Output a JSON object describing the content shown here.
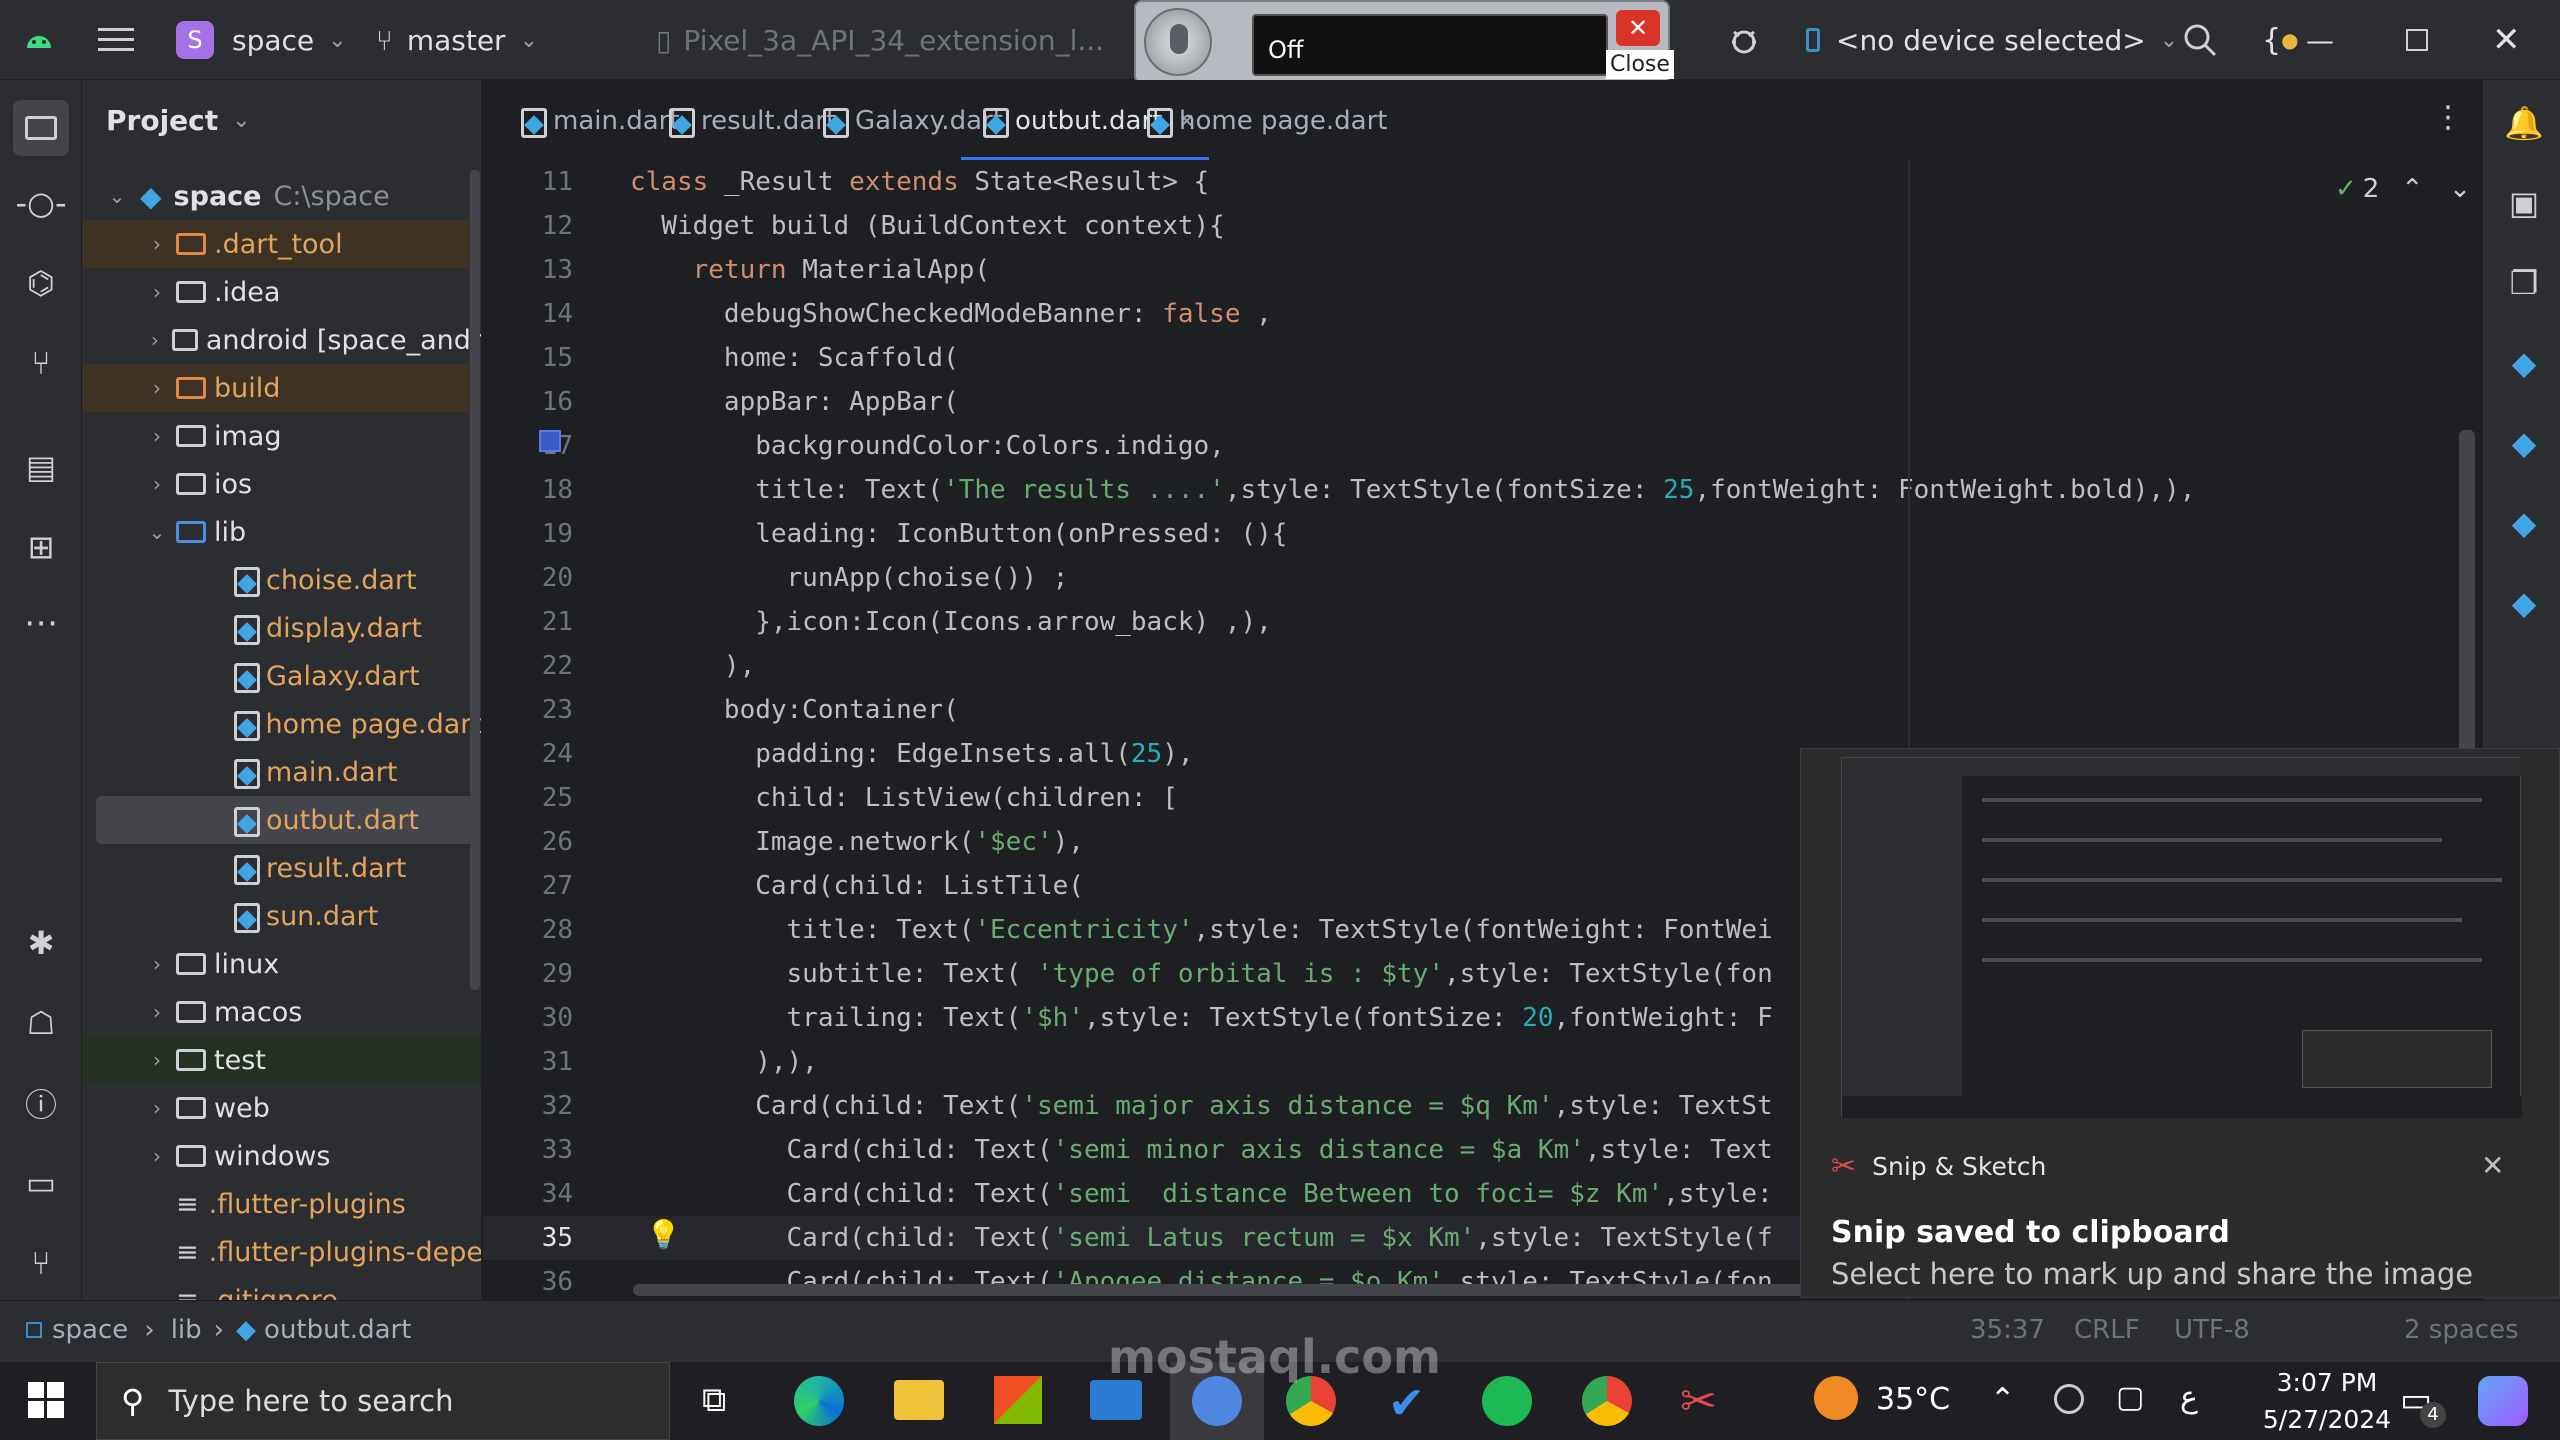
{
  "titlebar": {
    "project_badge": "S",
    "project_name": "space",
    "branch": "master",
    "device_config": "Pixel_3a_API_34_extension_l...",
    "device_selector": "<no device selected>"
  },
  "voice_widget": {
    "status": "Off",
    "close_label": "Close"
  },
  "project_panel": {
    "title": "Project",
    "root_name": "space",
    "root_path": "C:\\space",
    "items": [
      {
        "label": ".dart_tool",
        "kind": "folder",
        "color": "orange"
      },
      {
        "label": ".idea",
        "kind": "folder",
        "color": "normal"
      },
      {
        "label": "android [space_andr",
        "kind": "folder",
        "color": "normal"
      },
      {
        "label": "build",
        "kind": "folder",
        "color": "orange"
      },
      {
        "label": "imag",
        "kind": "folder",
        "color": "normal"
      },
      {
        "label": "ios",
        "kind": "folder",
        "color": "normal"
      },
      {
        "label": "lib",
        "kind": "folder-open",
        "color": "normal"
      },
      {
        "label": "choise.dart",
        "kind": "file",
        "color": "orange"
      },
      {
        "label": "display.dart",
        "kind": "file",
        "color": "orange"
      },
      {
        "label": "Galaxy.dart",
        "kind": "file",
        "color": "orange"
      },
      {
        "label": "home page.dart",
        "kind": "file",
        "color": "orange"
      },
      {
        "label": "main.dart",
        "kind": "file",
        "color": "orange"
      },
      {
        "label": "outbut.dart",
        "kind": "file",
        "color": "orange"
      },
      {
        "label": "result.dart",
        "kind": "file",
        "color": "orange"
      },
      {
        "label": "sun.dart",
        "kind": "file",
        "color": "orange"
      },
      {
        "label": "linux",
        "kind": "folder",
        "color": "normal"
      },
      {
        "label": "macos",
        "kind": "folder",
        "color": "normal"
      },
      {
        "label": "test",
        "kind": "folder",
        "color": "normal"
      },
      {
        "label": "web",
        "kind": "folder",
        "color": "normal"
      },
      {
        "label": "windows",
        "kind": "folder",
        "color": "normal"
      },
      {
        "label": ".flutter-plugins",
        "kind": "text",
        "color": "orange"
      },
      {
        "label": ".flutter-plugins-deper",
        "kind": "text",
        "color": "orange"
      },
      {
        "label": ".gitignore",
        "kind": "text",
        "color": "orange"
      }
    ]
  },
  "tabs": [
    {
      "label": "main.dart",
      "active": false
    },
    {
      "label": "result.dart",
      "active": false
    },
    {
      "label": "Galaxy.dart",
      "active": false
    },
    {
      "label": "outbut.dart",
      "active": true
    },
    {
      "label": "home page.dart",
      "active": false
    }
  ],
  "inspections": {
    "count": "2"
  },
  "code_lines": [
    {
      "n": "11",
      "segs": [
        [
          "kw",
          "class "
        ],
        [
          "",
          "_Result "
        ],
        [
          "kw",
          "extends "
        ],
        [
          "",
          "State<Result> {"
        ]
      ]
    },
    {
      "n": "12",
      "segs": [
        [
          "",
          "  Widget build (BuildContext context){"
        ]
      ]
    },
    {
      "n": "13",
      "segs": [
        [
          "kw",
          "    return "
        ],
        [
          "",
          "MaterialApp("
        ]
      ]
    },
    {
      "n": "14",
      "segs": [
        [
          "",
          "      debugShowCheckedModeBanner: "
        ],
        [
          "kw",
          "false"
        ],
        [
          "",
          " ,"
        ]
      ]
    },
    {
      "n": "15",
      "segs": [
        [
          "",
          "      home: Scaffold("
        ]
      ]
    },
    {
      "n": "16",
      "segs": [
        [
          "",
          "      appBar: AppBar("
        ]
      ]
    },
    {
      "n": "17",
      "segs": [
        [
          "",
          "        backgroundColor:Colors.indigo,"
        ]
      ]
    },
    {
      "n": "18",
      "segs": [
        [
          "",
          "        title: Text("
        ],
        [
          "str",
          "'The results ....'"
        ],
        [
          "",
          ",style: TextStyle(fontSize: "
        ],
        [
          "num",
          "25"
        ],
        [
          "",
          ",fontWeight: FontWeight.bold),),"
        ]
      ]
    },
    {
      "n": "19",
      "segs": [
        [
          "",
          "        leading: IconButton(onPressed: (){"
        ]
      ]
    },
    {
      "n": "20",
      "segs": [
        [
          "",
          "          runApp(choise()) ;"
        ]
      ]
    },
    {
      "n": "21",
      "segs": [
        [
          "",
          "        },icon:Icon(Icons.arrow_back) ,),"
        ]
      ]
    },
    {
      "n": "22",
      "segs": [
        [
          "",
          "      ),"
        ]
      ]
    },
    {
      "n": "23",
      "segs": [
        [
          "",
          "      body:Container("
        ]
      ]
    },
    {
      "n": "24",
      "segs": [
        [
          "",
          "        padding: EdgeInsets.all("
        ],
        [
          "num",
          "25"
        ],
        [
          "",
          "),"
        ]
      ]
    },
    {
      "n": "25",
      "segs": [
        [
          "",
          "        child: ListView(children: ["
        ]
      ]
    },
    {
      "n": "26",
      "segs": [
        [
          "",
          "        Image.network("
        ],
        [
          "str",
          "'$ec'"
        ],
        [
          "",
          "),"
        ]
      ]
    },
    {
      "n": "27",
      "segs": [
        [
          "",
          "        Card(child: ListTile("
        ]
      ]
    },
    {
      "n": "28",
      "segs": [
        [
          "",
          "          title: Text("
        ],
        [
          "str",
          "'Eccentricity'"
        ],
        [
          "",
          ",style: TextStyle(fontWeight: FontWei"
        ]
      ]
    },
    {
      "n": "29",
      "segs": [
        [
          "",
          "          subtitle: Text( "
        ],
        [
          "str",
          "'type of orbital is : $ty'"
        ],
        [
          "",
          ",style: TextStyle(fon"
        ]
      ]
    },
    {
      "n": "30",
      "segs": [
        [
          "",
          "          trailing: Text("
        ],
        [
          "str",
          "'$h'"
        ],
        [
          "",
          ",style: TextStyle(fontSize: "
        ],
        [
          "num",
          "20"
        ],
        [
          "",
          ",fontWeight: F"
        ]
      ]
    },
    {
      "n": "31",
      "segs": [
        [
          "",
          "        ),),"
        ]
      ]
    },
    {
      "n": "32",
      "segs": [
        [
          "",
          "        Card(child: Text("
        ],
        [
          "str",
          "'semi major axis distance = $q Km'"
        ],
        [
          "",
          ",style: TextSt"
        ]
      ]
    },
    {
      "n": "33",
      "segs": [
        [
          "",
          "          Card(child: Text("
        ],
        [
          "str",
          "'semi minor axis distance = $a Km'"
        ],
        [
          "",
          ",style: Text"
        ]
      ]
    },
    {
      "n": "34",
      "segs": [
        [
          "",
          "          Card(child: Text("
        ],
        [
          "str",
          "'semi  distance Between to foci= $z Km'"
        ],
        [
          "",
          ",style:"
        ]
      ]
    },
    {
      "n": "35",
      "segs": [
        [
          "",
          "          Card(child: Text("
        ],
        [
          "str",
          "'semi Latus rectum = $x Km'"
        ],
        [
          "",
          ",style: TextStyle(f"
        ]
      ]
    },
    {
      "n": "36",
      "segs": [
        [
          "",
          "          Card(child: Text("
        ],
        [
          "str",
          "'Apogee distance = $o Km'"
        ],
        [
          "",
          ",style: TextStyle(fon"
        ]
      ]
    }
  ],
  "notification": {
    "app_name": "Snip & Sketch",
    "title": "Snip saved to clipboard",
    "body": "Select here to mark up and share the image"
  },
  "statusbar": {
    "crumbs": [
      "space",
      "lib",
      "outbut.dart"
    ],
    "position": "35:37",
    "line_sep": "CRLF",
    "encoding": "UTF-8",
    "indent": "2 spaces"
  },
  "taskbar": {
    "search_placeholder": "Type here to search",
    "temperature": "35°C",
    "time": "3:07 PM",
    "date": "5/27/2024",
    "notif_count": "4",
    "lang": "ع"
  },
  "watermark": {
    "text": "mostaql.com"
  },
  "colors": {
    "accent": "#3574f0",
    "keyword": "#cf8e6d",
    "string": "#6aab73",
    "number": "#2aacb8",
    "bg": "#1e1f22",
    "panel": "#2b2d30"
  }
}
